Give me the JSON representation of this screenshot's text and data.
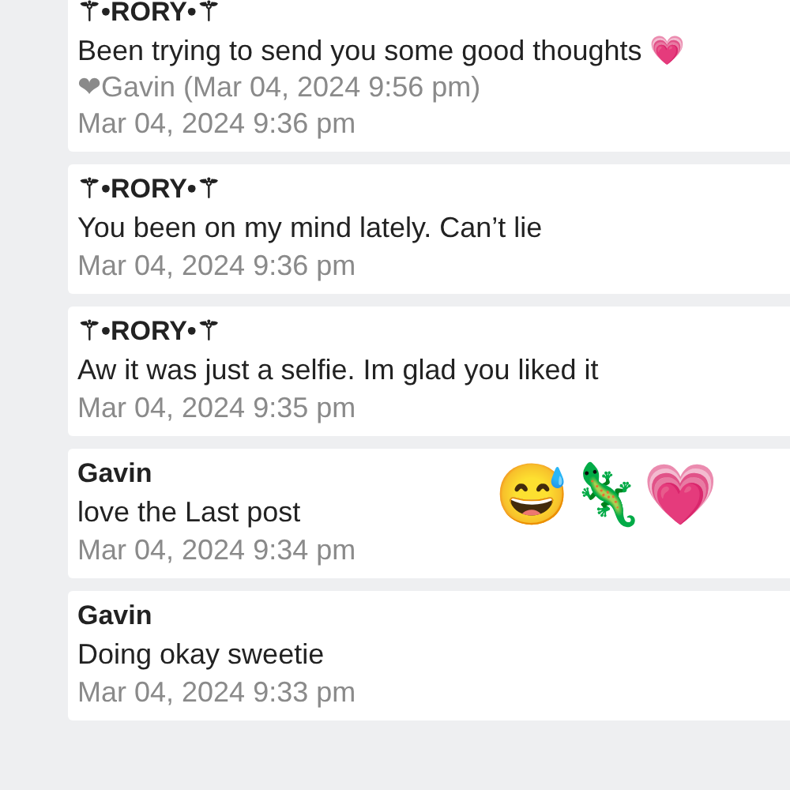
{
  "messages": [
    {
      "author": "⚚•RORY•⚚",
      "text": "Been trying to send you some good thoughts 💗",
      "reaction": "❤Gavin (Mar 04, 2024 9:56 pm)",
      "time": "Mar 04, 2024 9:36 pm"
    },
    {
      "author": "⚚•RORY•⚚",
      "text": "You been on my mind lately. Can’t lie",
      "time": "Mar 04, 2024 9:36 pm"
    },
    {
      "author": "⚚•RORY•⚚",
      "text": "Aw it was just a selfie. Im glad you liked it",
      "time": "Mar 04, 2024 9:35 pm"
    },
    {
      "author": "Gavin",
      "text": "love the Last post",
      "emoji": "😅🦎💗",
      "time": "Mar 04, 2024 9:34 pm"
    },
    {
      "author": "Gavin",
      "text": "Doing okay sweetie",
      "time": "Mar 04, 2024 9:33 pm"
    }
  ]
}
